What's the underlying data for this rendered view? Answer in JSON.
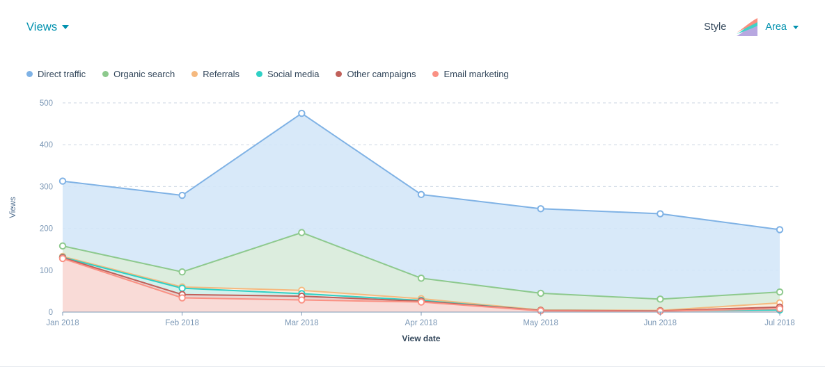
{
  "header": {
    "metric_label": "Views",
    "metric_caret_icon": "chevron-down-icon",
    "style_label": "Style",
    "style_value": "Area",
    "style_caret_icon": "chevron-down-icon",
    "style_icon": "area-chart-icon"
  },
  "legend": {
    "items": [
      {
        "label": "Direct traffic",
        "color": "#7fb2e5"
      },
      {
        "label": "Organic search",
        "color": "#8dc98d"
      },
      {
        "label": "Referrals",
        "color": "#f5b97f"
      },
      {
        "label": "Social media",
        "color": "#2fd0c5"
      },
      {
        "label": "Other campaigns",
        "color": "#c0605a"
      },
      {
        "label": "Email marketing",
        "color": "#fa9184"
      }
    ]
  },
  "chart_data": {
    "type": "area",
    "title": "Views",
    "xlabel": "View date",
    "ylabel": "Views",
    "grid": true,
    "legend_position": "top-left",
    "categories": [
      "Jan 2018",
      "Feb 2018",
      "Mar 2018",
      "Apr 2018",
      "May 2018",
      "Jun 2018",
      "Jul 2018"
    ],
    "yticks": [
      0,
      100,
      200,
      300,
      400,
      500
    ],
    "ylim": [
      0,
      500
    ],
    "series": [
      {
        "name": "Direct traffic",
        "color": "#7fb2e5",
        "fill": "#d3e6f8",
        "values": [
          313,
          279,
          475,
          281,
          247,
          235,
          197
        ]
      },
      {
        "name": "Organic search",
        "color": "#8dc98d",
        "fill": "#dcedda",
        "values": [
          158,
          96,
          190,
          81,
          45,
          31,
          48
        ]
      },
      {
        "name": "Referrals",
        "color": "#f5b97f",
        "fill": "#fdeedd",
        "values": [
          133,
          60,
          52,
          32,
          5,
          4,
          22
        ]
      },
      {
        "name": "Social media",
        "color": "#2fd0c5",
        "fill": "#cdf1ee",
        "values": [
          131,
          57,
          44,
          28,
          4,
          3,
          5
        ]
      },
      {
        "name": "Other campaigns",
        "color": "#c0605a",
        "fill": "#eccfcd",
        "values": [
          130,
          42,
          38,
          26,
          4,
          3,
          12
        ]
      },
      {
        "name": "Email marketing",
        "color": "#fa9184",
        "fill": "#fbdcd7",
        "values": [
          128,
          34,
          29,
          24,
          3,
          2,
          8
        ]
      }
    ]
  }
}
